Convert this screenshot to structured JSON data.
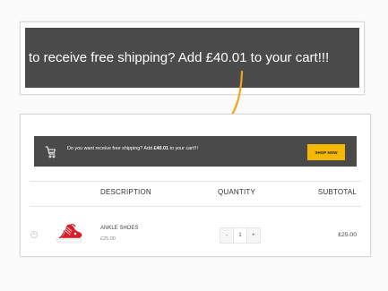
{
  "callout": {
    "text": "to receive free shipping? Add £40.01 to your cart!!!"
  },
  "notice": {
    "prefix": "Do you want receive free shipping? Add ",
    "amount": "£40.01",
    "suffix": " to your cart!!!",
    "button_label": "SHOP NOW"
  },
  "table": {
    "headers": {
      "description": "DESCRIPTION",
      "quantity": "QUANTITY",
      "subtotal": "SUBTOTAL"
    },
    "item": {
      "name": "ANKLE SHOES",
      "price": "£25.00",
      "qty_minus": "-",
      "quantity": "1",
      "qty_plus": "+",
      "subtotal": "£25.00"
    }
  },
  "icons": {
    "notice": "cart-icon",
    "remove": "remove-icon",
    "product": "red-shoe-image"
  },
  "colors": {
    "dark_banner": "#4a4a4a",
    "button_yellow": "#f5b800",
    "arrow_orange": "#f0a51c",
    "shoe_red": "#d51f2b"
  }
}
